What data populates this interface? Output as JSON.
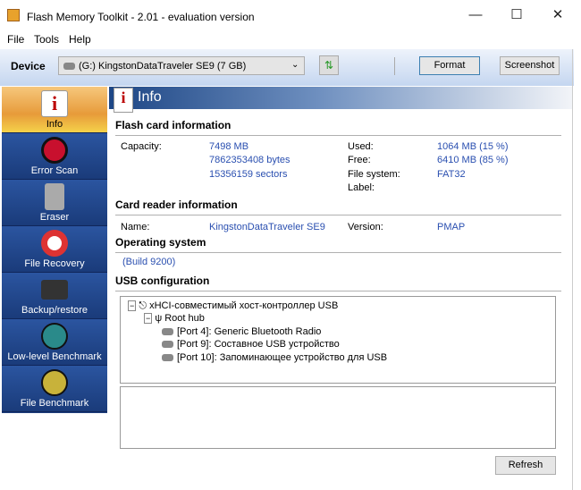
{
  "window": {
    "title": "Flash Memory Toolkit - 2.01 - evaluation version"
  },
  "menu": [
    "File",
    "Tools",
    "Help"
  ],
  "toolbar": {
    "device_label": "Device",
    "device_value": "(G:) KingstonDataTraveler SE9 (7 GB)",
    "format": "Format",
    "screenshot": "Screenshot"
  },
  "sidebar": [
    {
      "label": "Info",
      "icon": "info-icon"
    },
    {
      "label": "Error Scan",
      "icon": "magnifier-icon"
    },
    {
      "label": "Eraser",
      "icon": "trash-icon"
    },
    {
      "label": "File Recovery",
      "icon": "lifebuoy-icon"
    },
    {
      "label": "Backup/restore",
      "icon": "tape-icon"
    },
    {
      "label": "Low-level Benchmark",
      "icon": "stopwatch-icon"
    },
    {
      "label": "File Benchmark",
      "icon": "stopwatch-icon"
    }
  ],
  "header": {
    "title": "Info"
  },
  "flash": {
    "title": "Flash card information",
    "capacity_label": "Capacity:",
    "capacity_mb": "7498 MB",
    "capacity_bytes": "7862353408 bytes",
    "capacity_sectors": "15356159 sectors",
    "used_label": "Used:",
    "used": "1064 MB (15 %)",
    "free_label": "Free:",
    "free": "6410 MB (85 %)",
    "fs_label": "File system:",
    "fs": "FAT32",
    "label_label": "Label:"
  },
  "reader": {
    "title": "Card reader information",
    "name_label": "Name:",
    "name": "KingstonDataTraveler SE9",
    "version_label": "Version:",
    "version": "PMAP"
  },
  "os": {
    "title": "Operating system",
    "value": "(Build 9200)"
  },
  "usb": {
    "title": "USB configuration",
    "controller": "xHCI-совместимый хост-контроллер USB",
    "hub": "Root hub",
    "ports": [
      "[Port 4]: Generic Bluetooth Radio",
      "[Port 9]: Составное USB устройство",
      "[Port 10]: Запоминающее устройство для USB"
    ]
  },
  "refresh": "Refresh"
}
